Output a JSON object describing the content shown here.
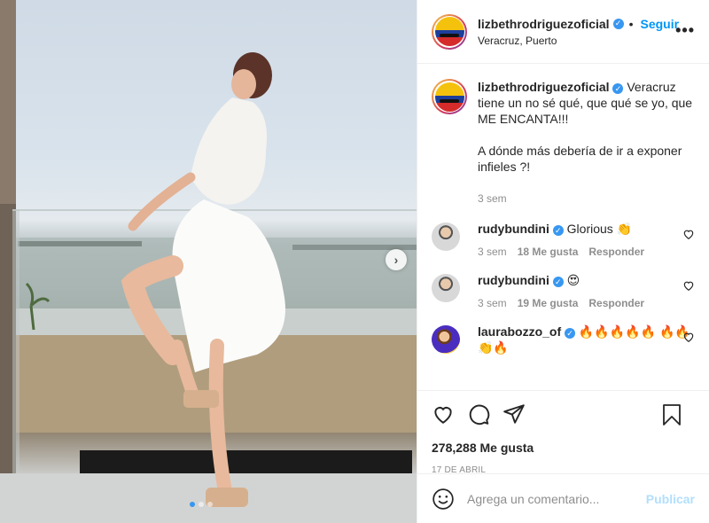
{
  "post": {
    "username": "lizbethrodriguezoficial",
    "follow_label": "Seguir",
    "location": "Veracruz, Puerto",
    "more_label": "•••"
  },
  "caption": {
    "username": "lizbethrodriguezoficial",
    "line1": "Veracruz tiene un no sé qué, que qué se yo, que ME ENCANTA!!!",
    "line2": "A dónde más debería de ir a exponer infieles ?!",
    "time": "3 sem"
  },
  "comments": [
    {
      "username": "rudybundini",
      "text": "Glorious 👏",
      "time": "3 sem",
      "likes": "18 Me gusta",
      "reply": "Responder"
    },
    {
      "username": "rudybundini",
      "text": "😍",
      "time": "3 sem",
      "likes": "19 Me gusta",
      "reply": "Responder"
    },
    {
      "username": "laurabozzo_of",
      "text": "🔥🔥🔥🔥🔥 🔥🔥👏🔥"
    }
  ],
  "stats": {
    "likes": "278,288 Me gusta",
    "date": "17 DE ABRIL"
  },
  "composer": {
    "placeholder": "Agrega un comentario...",
    "publish_label": "Publicar"
  },
  "carousel": {
    "slides": 3,
    "active": 1
  },
  "colors": {
    "accent": "#0095f6",
    "verified": "#3897f0",
    "muted": "#8e8e8e"
  },
  "icons": [
    "heart-icon",
    "comment-icon",
    "share-icon",
    "bookmark-icon",
    "emoji-icon",
    "verified-icon",
    "more-icon",
    "chevron-right-icon"
  ]
}
